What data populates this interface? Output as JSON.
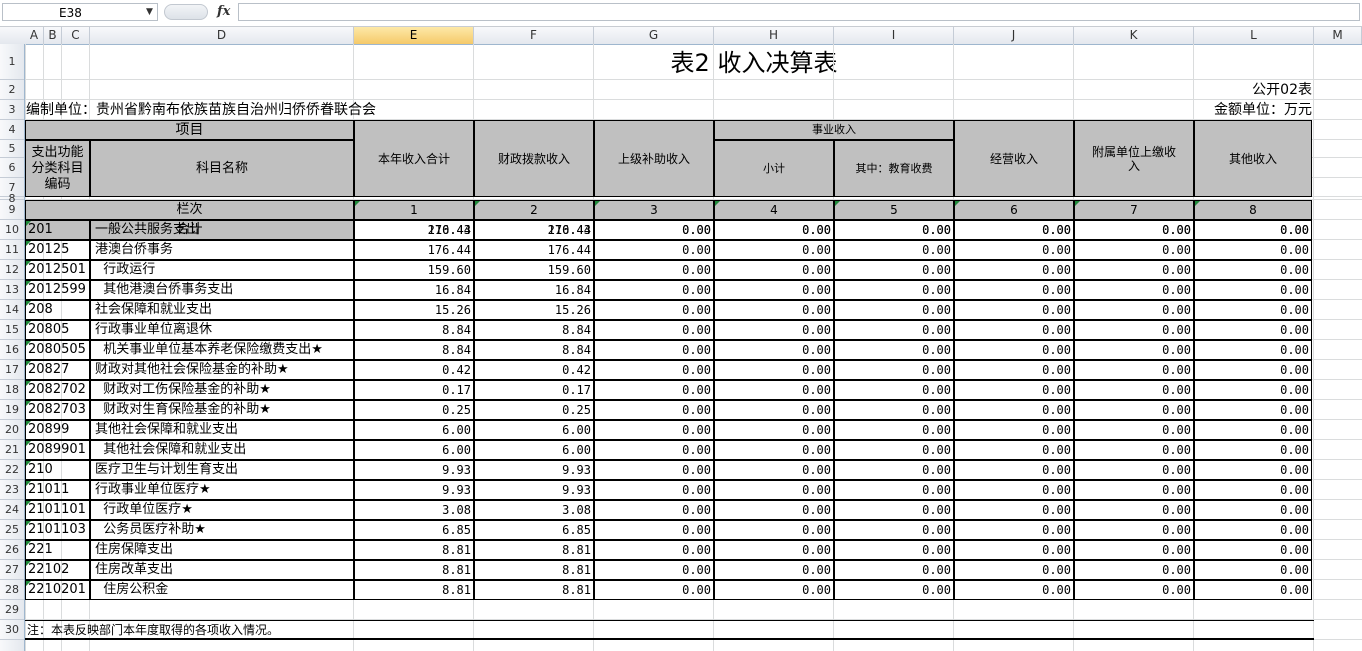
{
  "formula_bar": {
    "cell_ref": "E38",
    "fx": "fx",
    "formula": ""
  },
  "columns": [
    "A",
    "B",
    "C",
    "D",
    "E",
    "F",
    "G",
    "H",
    "I",
    "J",
    "K",
    "L",
    "M"
  ],
  "selected_column": "E",
  "sheet": {
    "title": "表2  收入决算表",
    "form_code": "公开02表",
    "unit_label": "编制单位：贵州省黔南布依族苗族自治州归侨侨眷联合会",
    "amount_unit": "金额单位：万元",
    "headers": {
      "xiangmu": "项目",
      "func_code": "支出功能分类科目编码",
      "subject_name": "科目名称",
      "total": "本年收入合计",
      "fiscal": "财政拨款收入",
      "upper": "上级补助收入",
      "shiye": "事业收入",
      "subtotal": "小计",
      "edu": "其中：教育收费",
      "business": "经营收入",
      "affiliate": "附属单位上缴收入",
      "other": "其他收入",
      "lanci": "栏次",
      "heji": "合计"
    },
    "col_numbers": [
      "1",
      "2",
      "3",
      "4",
      "5",
      "6",
      "7",
      "8"
    ],
    "total_row": [
      "210.43",
      "210.43",
      "0.00",
      "0.00",
      "0.00",
      "0.00",
      "0.00",
      "0.00"
    ],
    "rows": [
      {
        "code": "201",
        "name": "一般公共服务支出",
        "vals": [
          "176.44",
          "176.44",
          "0.00",
          "0.00",
          "0.00",
          "0.00",
          "0.00",
          "0.00"
        ]
      },
      {
        "code": "20125",
        "name": "港澳台侨事务",
        "vals": [
          "176.44",
          "176.44",
          "0.00",
          "0.00",
          "0.00",
          "0.00",
          "0.00",
          "0.00"
        ]
      },
      {
        "code": "2012501",
        "name": "  行政运行",
        "vals": [
          "159.60",
          "159.60",
          "0.00",
          "0.00",
          "0.00",
          "0.00",
          "0.00",
          "0.00"
        ]
      },
      {
        "code": "2012599",
        "name": "  其他港澳台侨事务支出",
        "vals": [
          "16.84",
          "16.84",
          "0.00",
          "0.00",
          "0.00",
          "0.00",
          "0.00",
          "0.00"
        ]
      },
      {
        "code": "208",
        "name": "社会保障和就业支出",
        "vals": [
          "15.26",
          "15.26",
          "0.00",
          "0.00",
          "0.00",
          "0.00",
          "0.00",
          "0.00"
        ]
      },
      {
        "code": "20805",
        "name": "行政事业单位离退休",
        "vals": [
          "8.84",
          "8.84",
          "0.00",
          "0.00",
          "0.00",
          "0.00",
          "0.00",
          "0.00"
        ]
      },
      {
        "code": "2080505",
        "name": "  机关事业单位基本养老保险缴费支出★",
        "vals": [
          "8.84",
          "8.84",
          "0.00",
          "0.00",
          "0.00",
          "0.00",
          "0.00",
          "0.00"
        ]
      },
      {
        "code": "20827",
        "name": "财政对其他社会保险基金的补助★",
        "vals": [
          "0.42",
          "0.42",
          "0.00",
          "0.00",
          "0.00",
          "0.00",
          "0.00",
          "0.00"
        ]
      },
      {
        "code": "2082702",
        "name": "  财政对工伤保险基金的补助★",
        "vals": [
          "0.17",
          "0.17",
          "0.00",
          "0.00",
          "0.00",
          "0.00",
          "0.00",
          "0.00"
        ]
      },
      {
        "code": "2082703",
        "name": "  财政对生育保险基金的补助★",
        "vals": [
          "0.25",
          "0.25",
          "0.00",
          "0.00",
          "0.00",
          "0.00",
          "0.00",
          "0.00"
        ]
      },
      {
        "code": "20899",
        "name": "其他社会保障和就业支出",
        "vals": [
          "6.00",
          "6.00",
          "0.00",
          "0.00",
          "0.00",
          "0.00",
          "0.00",
          "0.00"
        ]
      },
      {
        "code": "2089901",
        "name": "  其他社会保障和就业支出",
        "vals": [
          "6.00",
          "6.00",
          "0.00",
          "0.00",
          "0.00",
          "0.00",
          "0.00",
          "0.00"
        ]
      },
      {
        "code": "210",
        "name": "医疗卫生与计划生育支出",
        "vals": [
          "9.93",
          "9.93",
          "0.00",
          "0.00",
          "0.00",
          "0.00",
          "0.00",
          "0.00"
        ]
      },
      {
        "code": "21011",
        "name": "行政事业单位医疗★",
        "vals": [
          "9.93",
          "9.93",
          "0.00",
          "0.00",
          "0.00",
          "0.00",
          "0.00",
          "0.00"
        ]
      },
      {
        "code": "2101101",
        "name": "  行政单位医疗★",
        "vals": [
          "3.08",
          "3.08",
          "0.00",
          "0.00",
          "0.00",
          "0.00",
          "0.00",
          "0.00"
        ]
      },
      {
        "code": "2101103",
        "name": "  公务员医疗补助★",
        "vals": [
          "6.85",
          "6.85",
          "0.00",
          "0.00",
          "0.00",
          "0.00",
          "0.00",
          "0.00"
        ]
      },
      {
        "code": "221",
        "name": "住房保障支出",
        "vals": [
          "8.81",
          "8.81",
          "0.00",
          "0.00",
          "0.00",
          "0.00",
          "0.00",
          "0.00"
        ]
      },
      {
        "code": "22102",
        "name": "住房改革支出",
        "vals": [
          "8.81",
          "8.81",
          "0.00",
          "0.00",
          "0.00",
          "0.00",
          "0.00",
          "0.00"
        ]
      },
      {
        "code": "2210201",
        "name": "  住房公积金",
        "vals": [
          "8.81",
          "8.81",
          "0.00",
          "0.00",
          "0.00",
          "0.00",
          "0.00",
          "0.00"
        ]
      }
    ],
    "note": "注：本表反映部门本年度取得的各项收入情况。"
  },
  "row_numbers": [
    "1",
    "2",
    "3",
    "4",
    "5",
    "6",
    "7",
    "8",
    "9",
    "10",
    "11",
    "12",
    "13",
    "14",
    "15",
    "16",
    "17",
    "18",
    "19",
    "20",
    "21",
    "22",
    "23",
    "24",
    "25",
    "26",
    "27",
    "28",
    "29",
    "30"
  ]
}
